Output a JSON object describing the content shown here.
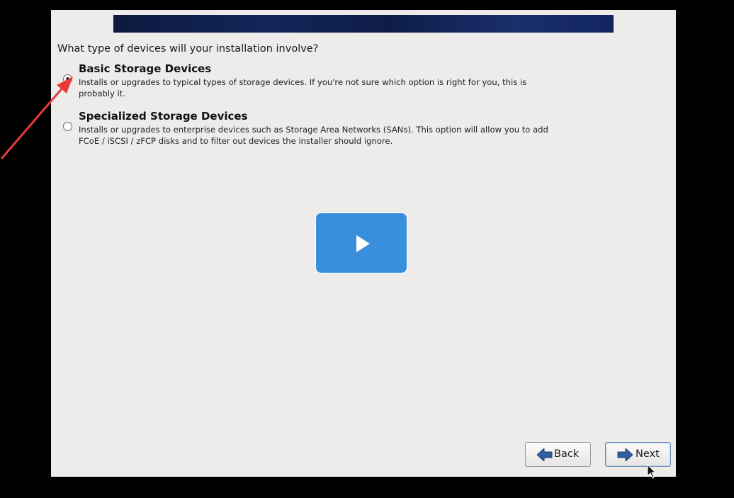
{
  "installer": {
    "question": "What type of devices will your installation involve?",
    "options": [
      {
        "title": "Basic Storage Devices",
        "description": "Installs or upgrades to typical types of storage devices.  If you're not sure which option is right for you, this is probably it.",
        "selected": true
      },
      {
        "title": "Specialized Storage Devices",
        "description": "Installs or upgrades to enterprise devices such as Storage Area Networks (SANs). This option will allow you to add FCoE / iSCSI / zFCP disks and to filter out devices the installer should ignore.",
        "selected": false
      }
    ],
    "buttons": {
      "back_label": "Back",
      "next_label": "Next"
    }
  },
  "overlay": {
    "play_icon": "play-icon",
    "play_color": "#3a8fdc",
    "annotation_color": "#e83a3a"
  },
  "icons": {
    "back": "arrow-left-icon",
    "next": "arrow-right-icon",
    "cursor": "mouse-pointer-icon"
  }
}
